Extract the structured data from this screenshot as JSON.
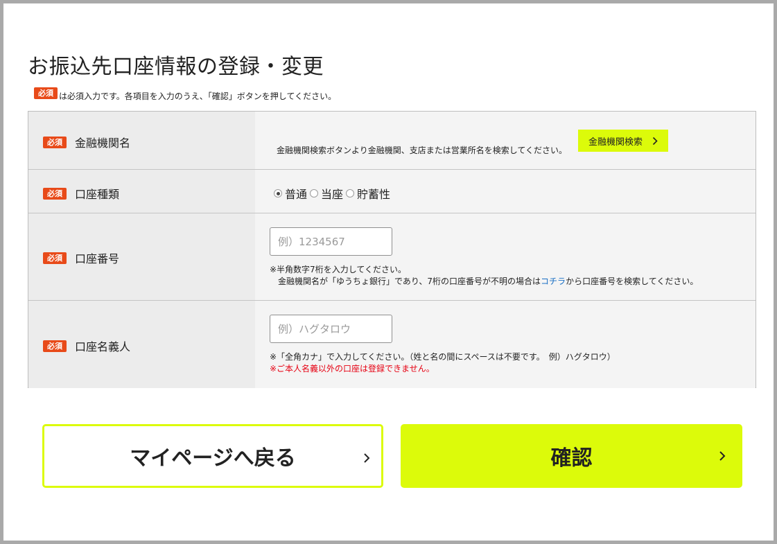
{
  "page": {
    "title": "お振込先口座情報の登録・変更",
    "required_badge": "必須",
    "required_note": "は必須入力です。各項目を入力のうえ、「確認」ボタンを押してください。"
  },
  "form": {
    "bank": {
      "label": "金融機関名",
      "help": "金融機関検索ボタンより金融機関、支店または営業所名を検索してください。",
      "search_button": "金融機関検索"
    },
    "account_type": {
      "label": "口座種類",
      "options": [
        "普通",
        "当座",
        "貯蓄性"
      ],
      "selected": "普通"
    },
    "account_number": {
      "label": "口座番号",
      "placeholder": "例）1234567",
      "value": "",
      "help1": "※半角数字7桁を入力してください。",
      "help2_before": "金融機関名が「ゆうちょ銀行」であり、7桁の口座番号が不明の場合は",
      "help2_link": "コチラ",
      "help2_after": "から口座番号を検索してください。"
    },
    "account_holder": {
      "label": "口座名義人",
      "placeholder": "例）ハグタロウ",
      "value": "",
      "help1": "※「全角カナ」で入力してください。（姓と名の間にスペースは不要です。　例）ハグタロウ）",
      "help2": "※ご本人名義以外の口座は登録できません。"
    }
  },
  "actions": {
    "back_label": "マイページへ戻る",
    "confirm_label": "確認"
  },
  "colors": {
    "accent": "#dcfb0a",
    "required_badge": "#e84a19",
    "link": "#1a6fc4",
    "warning": "#e60012"
  },
  "icons": {
    "chevron": "chevron-right-icon"
  }
}
